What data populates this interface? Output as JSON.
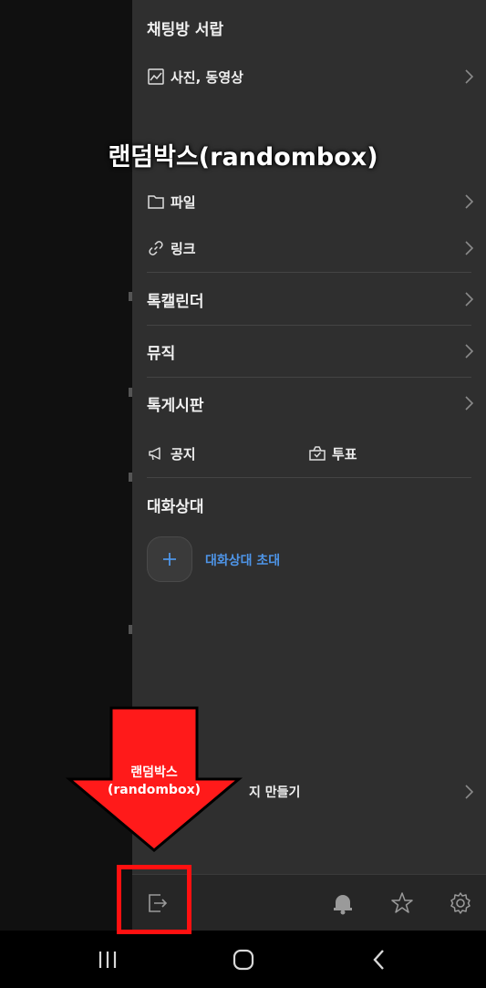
{
  "drawer": {
    "storage_title": "채팅방 서랍",
    "media_label": "사진, 동영상",
    "file_label": "파일",
    "link_label": "링크",
    "calendar_label": "톡캘린더",
    "music_label": "뮤직",
    "board_label": "톡게시판",
    "notice_label": "공지",
    "vote_label": "투표",
    "members_title": "대화상대",
    "invite_label": "대화상대 초대",
    "make_label_partial": "지 만들기"
  },
  "overlay": {
    "caption": "랜덤박스(randombox)",
    "arrow_line1": "랜덤박스",
    "arrow_line2": "(randombox)"
  },
  "footer": {
    "icons": [
      "exit-icon",
      "bell-icon",
      "star-icon",
      "gear-icon"
    ]
  },
  "navbar": {
    "icons": [
      "recent-apps-icon",
      "home-icon",
      "back-icon"
    ]
  },
  "colors": {
    "drawer_bg": "#2f2f2f",
    "accent_link": "#4e95e8",
    "highlight_red": "#ff1010"
  }
}
